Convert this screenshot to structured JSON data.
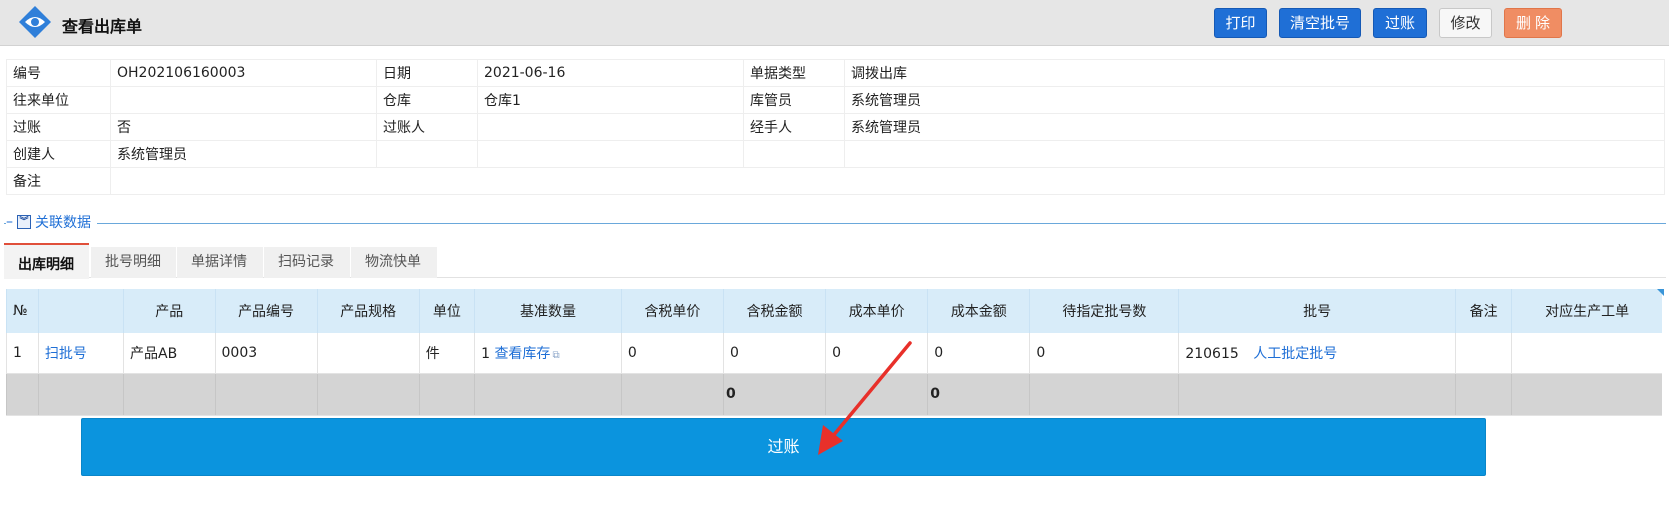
{
  "header": {
    "title": "查看出库单",
    "buttons": {
      "print": "打印",
      "clear_batch": "清空批号",
      "post": "过账",
      "edit": "修改",
      "delete": "删除"
    }
  },
  "info": {
    "labels": {
      "code": "编号",
      "date": "日期",
      "type": "单据类型",
      "partner": "往来单位",
      "warehouse": "仓库",
      "keeper": "库管员",
      "posted": "过账",
      "poster": "过账人",
      "handler": "经手人",
      "creator": "创建人",
      "remark": "备注"
    },
    "values": {
      "code": "OH202106160003",
      "date": "2021-06-16",
      "type": "调拨出库",
      "partner": "",
      "warehouse": "仓库1",
      "keeper": "系统管理员",
      "posted": "否",
      "poster": "",
      "handler": "系统管理员",
      "creator": "系统管理员",
      "remark": ""
    }
  },
  "section": {
    "label": "关联数据"
  },
  "tabs": [
    "出库明细",
    "批号明细",
    "单据详情",
    "扫码记录",
    "物流快单"
  ],
  "grid": {
    "columns": [
      "№",
      "",
      "产品",
      "产品编号",
      "产品规格",
      "单位",
      "基准数量",
      "含税单价",
      "含税金额",
      "成本单价",
      "成本金额",
      "待指定批号数",
      "批号",
      "备注",
      "对应生产工单"
    ],
    "row": {
      "no": "1",
      "scan": "扫批号",
      "product": "产品AB",
      "product_code": "0003",
      "spec": "",
      "unit": "件",
      "qty": "1",
      "view_stock": "查看库存",
      "tax_price": "0",
      "tax_amount": "0",
      "cost_price": "0",
      "cost_amount": "0",
      "pending_batch": "0",
      "batch_no": "210615",
      "manual_batch": "人工批定批号",
      "remark": "",
      "work_order": ""
    },
    "sum": {
      "tax_amount": "0",
      "cost_amount": "0"
    }
  },
  "footer": {
    "post_label": "过账"
  },
  "colors": {
    "primary": "#1f6fd6",
    "submit": "#0b94de",
    "danger": "#f08d63",
    "arrow": "#e8302a"
  }
}
